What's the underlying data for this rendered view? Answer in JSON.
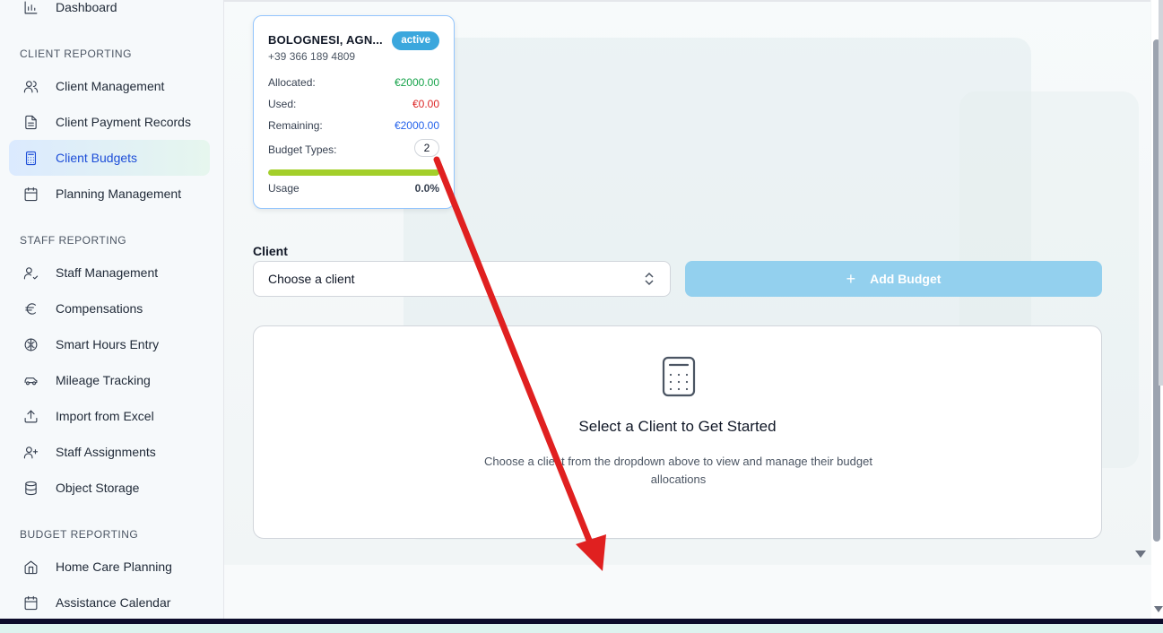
{
  "sidebar": {
    "top_item": {
      "label": "Dashboard",
      "icon": "bar-chart-icon"
    },
    "sections": [
      {
        "label": "CLIENT REPORTING"
      },
      {
        "label": "STAFF REPORTING"
      },
      {
        "label": "BUDGET REPORTING"
      }
    ],
    "client_items": [
      {
        "label": "Client Management",
        "icon": "users-icon"
      },
      {
        "label": "Client Payment Records",
        "icon": "document-icon"
      },
      {
        "label": "Client Budgets",
        "icon": "calculator-icon",
        "active": true
      },
      {
        "label": "Planning Management",
        "icon": "calendar-icon"
      }
    ],
    "staff_items": [
      {
        "label": "Staff Management",
        "icon": "user-check-icon"
      },
      {
        "label": "Compensations",
        "icon": "euro-icon"
      },
      {
        "label": "Smart Hours Entry",
        "icon": "brain-icon"
      },
      {
        "label": "Mileage Tracking",
        "icon": "car-icon"
      },
      {
        "label": "Import from Excel",
        "icon": "upload-icon"
      },
      {
        "label": "Staff Assignments",
        "icon": "user-plus-icon"
      },
      {
        "label": "Object Storage",
        "icon": "database-icon"
      }
    ],
    "budget_items": [
      {
        "label": "Home Care Planning",
        "icon": "home-icon"
      },
      {
        "label": "Assistance Calendar",
        "icon": "calendar-icon"
      }
    ]
  },
  "client_card": {
    "name": "BOLOGNESI, AGN...",
    "phone": "+39 366 189 4809",
    "status": "active",
    "allocated_label": "Allocated:",
    "allocated_value": "€2000.00",
    "used_label": "Used:",
    "used_value": "€0.00",
    "remaining_label": "Remaining:",
    "remaining_value": "€2000.00",
    "budget_types_label": "Budget Types:",
    "budget_types_value": "2",
    "usage_label": "Usage",
    "usage_value": "0.0%",
    "progress_bar_fill": 1.0
  },
  "client_select": {
    "label": "Client",
    "value": "Choose a client"
  },
  "add_budget": {
    "label": "Add Budget",
    "plus": "+"
  },
  "empty_state": {
    "icon": "calculator-icon",
    "title": "Select a Client to Get Started",
    "description": "Choose a client from the dropdown above to view and manage their budget allocations"
  },
  "colors": {
    "accent_blue": "#1d4ed8",
    "badge": "#3ba7dd",
    "allocated": "#16a34a",
    "used": "#dc2626",
    "remaining": "#2563eb",
    "progress": "#a3cf2a",
    "annotation_arrow": "#e02020"
  }
}
